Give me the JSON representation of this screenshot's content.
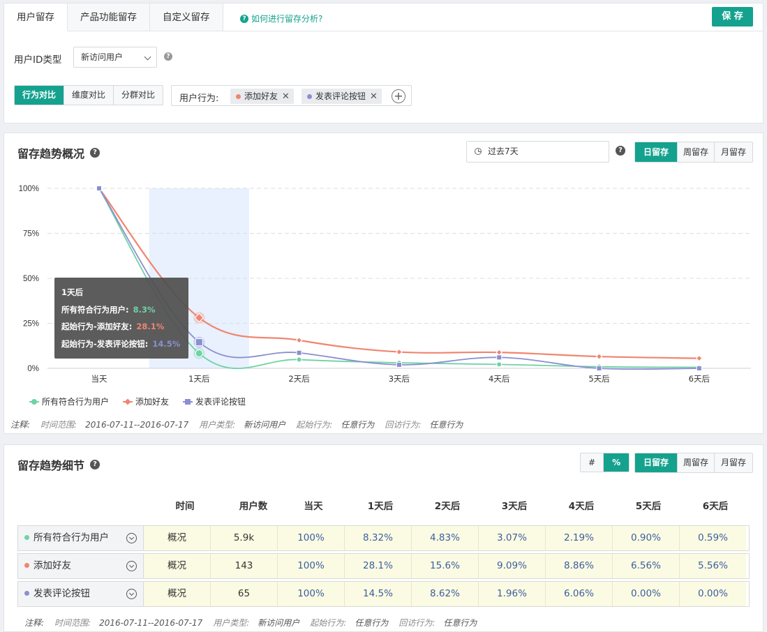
{
  "tabs": [
    "用户留存",
    "产品功能留存",
    "自定义留存"
  ],
  "help_link": "如何进行留存分析?",
  "save_label": "保 存",
  "filter": {
    "user_id_label": "用户ID类型",
    "user_id_value": "新访问用户",
    "compare_modes": [
      "行为对比",
      "维度对比",
      "分群对比"
    ],
    "behavior_label": "用户行为:",
    "chips": [
      {
        "label": "添加好友",
        "color": "#f08570"
      },
      {
        "label": "发表评论按钮",
        "color": "#8b8fd0"
      }
    ]
  },
  "overview": {
    "title": "留存趋势概况",
    "date_range": "过去7天",
    "periods": [
      "日留存",
      "周留存",
      "月留存"
    ]
  },
  "chart_data": {
    "type": "line",
    "categories": [
      "当天",
      "1天后",
      "2天后",
      "3天后",
      "4天后",
      "5天后",
      "6天后"
    ],
    "y_ticks": [
      "100%",
      "75%",
      "50%",
      "25%",
      "0%"
    ],
    "ylim": [
      0,
      100
    ],
    "series": [
      {
        "name": "所有符合行为用户",
        "color": "#6fd2a5",
        "marker": "circle",
        "values": [
          100,
          8.32,
          4.83,
          3.07,
          2.19,
          0.9,
          0.59
        ]
      },
      {
        "name": "添加好友",
        "color": "#f08570",
        "marker": "diamond",
        "values": [
          100,
          28.1,
          15.6,
          9.09,
          8.86,
          6.56,
          5.56
        ]
      },
      {
        "name": "发表评论按钮",
        "color": "#8b8fd0",
        "marker": "square",
        "values": [
          100,
          14.5,
          8.62,
          1.96,
          6.06,
          0.0,
          0.0
        ]
      }
    ],
    "highlight_category": "1天后",
    "tooltip": {
      "title": "1天后",
      "rows": [
        {
          "label": "所有符合行为用户:",
          "value": "8.3%",
          "color": "#6fd2a5"
        },
        {
          "label": "起始行为-添加好友:",
          "value": "28.1%",
          "color": "#f08570"
        },
        {
          "label": "起始行为-发表评论按钮:",
          "value": "14.5%",
          "color": "#8b8fd0"
        }
      ]
    }
  },
  "note": {
    "prefix": "注释:",
    "time_label": "时间范围:",
    "time_value": "2016-07-11--2016-07-17",
    "usertype_label": "用户类型:",
    "usertype_value": "新访问用户",
    "start_label": "起始行为:",
    "start_value": "任意行为",
    "return_label": "回访行为:",
    "return_value": "任意行为"
  },
  "detail": {
    "title": "留存趋势细节",
    "format_toggle": [
      "#",
      "%"
    ],
    "periods": [
      "日留存",
      "周留存",
      "月留存"
    ],
    "headers": [
      "时间",
      "用户数",
      "当天",
      "1天后",
      "2天后",
      "3天后",
      "4天后",
      "5天后",
      "6天后"
    ],
    "rows": [
      {
        "name": "所有符合行为用户",
        "color": "#6fd2a5",
        "time": "概况",
        "users": "5.9k",
        "values": [
          "100%",
          "8.32%",
          "4.83%",
          "3.07%",
          "2.19%",
          "0.90%",
          "0.59%"
        ]
      },
      {
        "name": "添加好友",
        "color": "#f08570",
        "time": "概况",
        "users": "143",
        "values": [
          "100%",
          "28.1%",
          "15.6%",
          "9.09%",
          "8.86%",
          "6.56%",
          "5.56%"
        ]
      },
      {
        "name": "发表评论按钮",
        "color": "#8b8fd0",
        "time": "概况",
        "users": "65",
        "values": [
          "100%",
          "14.5%",
          "8.62%",
          "1.96%",
          "6.06%",
          "0.00%",
          "0.00%"
        ]
      }
    ]
  }
}
